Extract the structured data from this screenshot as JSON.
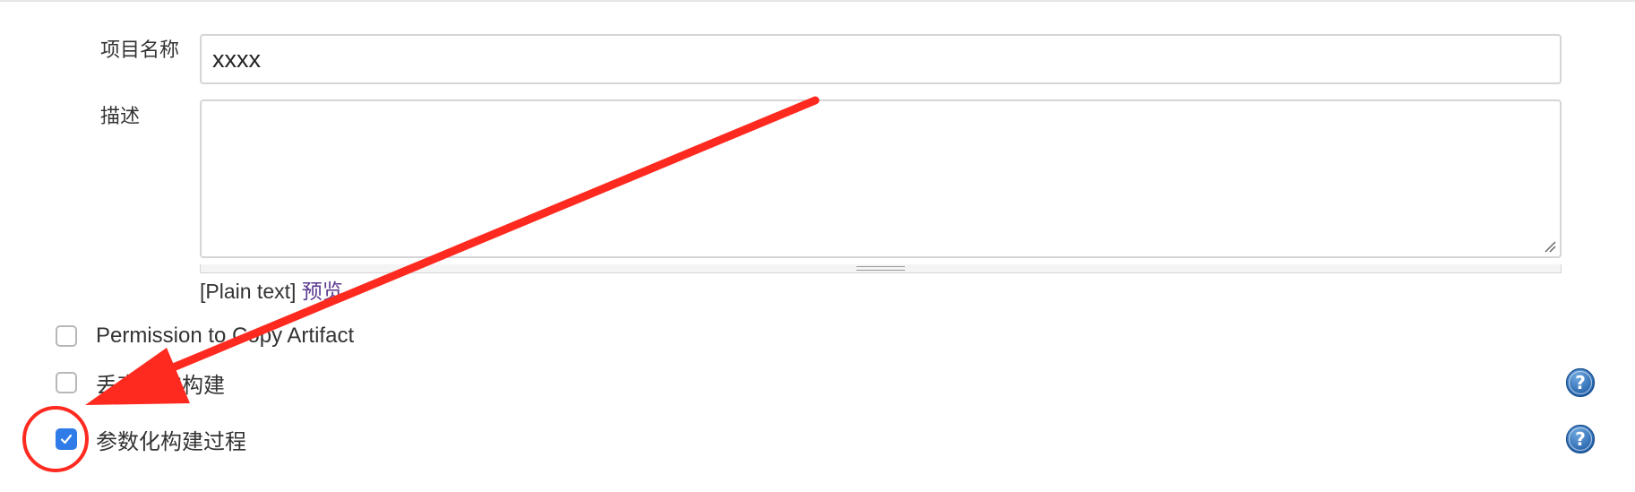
{
  "form": {
    "project_name": {
      "label": "项目名称",
      "value": "xxxx"
    },
    "description": {
      "label": "描述",
      "value": ""
    },
    "markup": {
      "format": "[Plain text]",
      "preview_link": "预览"
    },
    "options": [
      {
        "label": "Permission to Copy Artifact",
        "checked": false,
        "help": false
      },
      {
        "label": "丢弃旧的构建",
        "checked": false,
        "help": true
      },
      {
        "label": "参数化构建过程",
        "checked": true,
        "help": true
      }
    ]
  },
  "annotation": {
    "color": "#ff2a1f",
    "arrow": "points to checked checkbox",
    "circle": "highlights 参数化构建过程 checkbox"
  },
  "icons": {
    "help": "help-icon",
    "check": "checkmark-icon",
    "resize": "resize-grip-icon"
  }
}
